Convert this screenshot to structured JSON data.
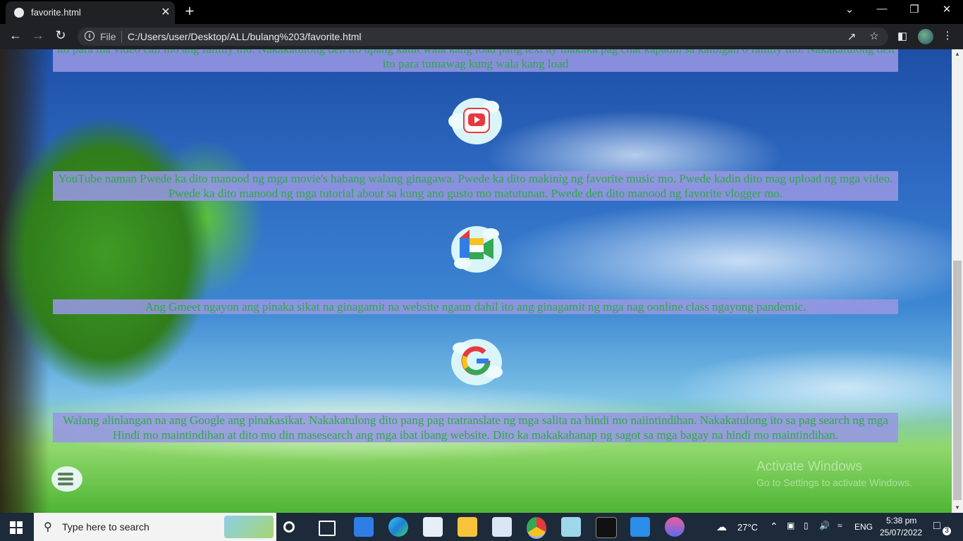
{
  "browser": {
    "tab_title": "favorite.html",
    "tab_close": "✕",
    "new_tab": "+",
    "scheme_label": "File",
    "url": "C:/Users/user/Desktop/ALL/bulang%203/favorite.html"
  },
  "window_controls": {
    "dropdown": "⌄",
    "minimize": "—",
    "restore": "❐",
    "close": "✕"
  },
  "page": {
    "messenger_text": "ito para ma video call mo ang family mo. Nakakatulong den ito upang kahit wala kang load pang text ay makaka pag chat kapadin sa kaibigan o family mo. Nakakatulong den ito para tumawag kung wala kang load",
    "youtube_text": "YouTube naman Pwede ka dito manood ng mga movie's habang walang ginagawa. Pwede ka dito makinig ng favorite music mo. Pwede kadin dito mag upload ng mga video. Pwede ka dito manood ng mga tutorial about sa kung ano gusto mo matutunan. Pwede den dito manood ng favorite vlogger mo.",
    "gmeet_text": "Ang Gmeet ngayon ang pinaka sikat na ginagamit na website ngaun dahil ito ang ginagamit ng mga nag oonline class ngayong pandemic.",
    "google_text": "Walang alinlangan na ang Google ang pinakasikat. Nakakatulong dito pang pag tratranslate ng mga salita na hindi mo naiintindihan. Nakakatulong ito sa pag search ng mga Hindi mo maintindihan at dito mo din masesearch ang mga ibat ibang website. Dito ka makakahanap ng sagot sa mga bagay na hindi mo maintindihan.",
    "icons": [
      "youtube-icon",
      "gmeet-icon",
      "google-icon",
      "menu-icon"
    ]
  },
  "watermark": {
    "title": "Activate Windows",
    "subtitle": "Go to Settings to activate Windows."
  },
  "taskbar": {
    "search_placeholder": "Type here to search",
    "weather": "27°C",
    "language": "ENG",
    "time": "5:38 pm",
    "date": "25/07/2022",
    "notification_count": "3"
  }
}
